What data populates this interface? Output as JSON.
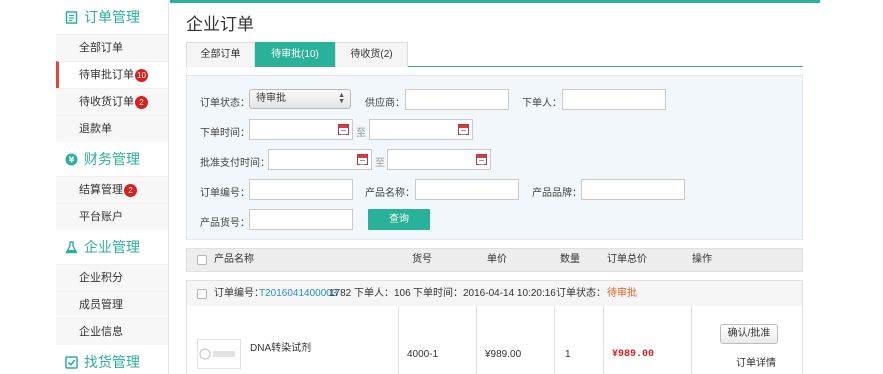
{
  "sidebar": {
    "sections": [
      {
        "title": "订单管理",
        "items": [
          {
            "label": "全部订单",
            "badge": ""
          },
          {
            "label": "待审批订单",
            "badge": "10"
          },
          {
            "label": "待收货订单",
            "badge": "2"
          },
          {
            "label": "退款单",
            "badge": ""
          }
        ]
      },
      {
        "title": "财务管理",
        "items": [
          {
            "label": "结算管理",
            "badge": "2"
          },
          {
            "label": "平台账户",
            "badge": ""
          }
        ]
      },
      {
        "title": "企业管理",
        "items": [
          {
            "label": "企业积分",
            "badge": ""
          },
          {
            "label": "成员管理",
            "badge": ""
          },
          {
            "label": "企业信息",
            "badge": ""
          }
        ]
      },
      {
        "title": "找货管理",
        "items": []
      }
    ]
  },
  "main": {
    "title": "企业订单",
    "tabs": [
      "全部订单",
      "待审批(10)",
      "待收货(2)"
    ],
    "active_tab": 1,
    "filter": {
      "status_label": "订单状态：",
      "status_value": "待审批",
      "supplier_label": "供应商：",
      "orderer_label": "下单人：",
      "order_time_label": "下单时间：",
      "to_text": "至",
      "pay_time_label": "批准支付时间：",
      "order_no_label": "订单编号：",
      "product_name_label": "产品名称：",
      "brand_label": "产品品牌：",
      "sku_label": "产品货号：",
      "query_button": "查询"
    },
    "table": {
      "headers": [
        "产品名称",
        "货号",
        "单价",
        "数量",
        "订单总价",
        "操作"
      ],
      "order": {
        "order_no_label": "订单编号：",
        "order_no": "T2016041400003",
        "suffix": "1782",
        "orderer": "下单人：106",
        "time": "下单时间：2016-04-14 10:20:16",
        "status_label": "订单状态：",
        "status": "待审批"
      },
      "row": {
        "product": "DNA转染试剂",
        "sku": "4000-1",
        "unit_price": "¥989.00",
        "qty": "1",
        "total": "¥989.00",
        "confirm_button": "确认/批准",
        "detail_link": "订单详情"
      }
    }
  },
  "colors": {
    "accent": "#2ab19a",
    "badge": "#d7201b",
    "link": "#2a8fc9",
    "status": "#e55f1e"
  }
}
